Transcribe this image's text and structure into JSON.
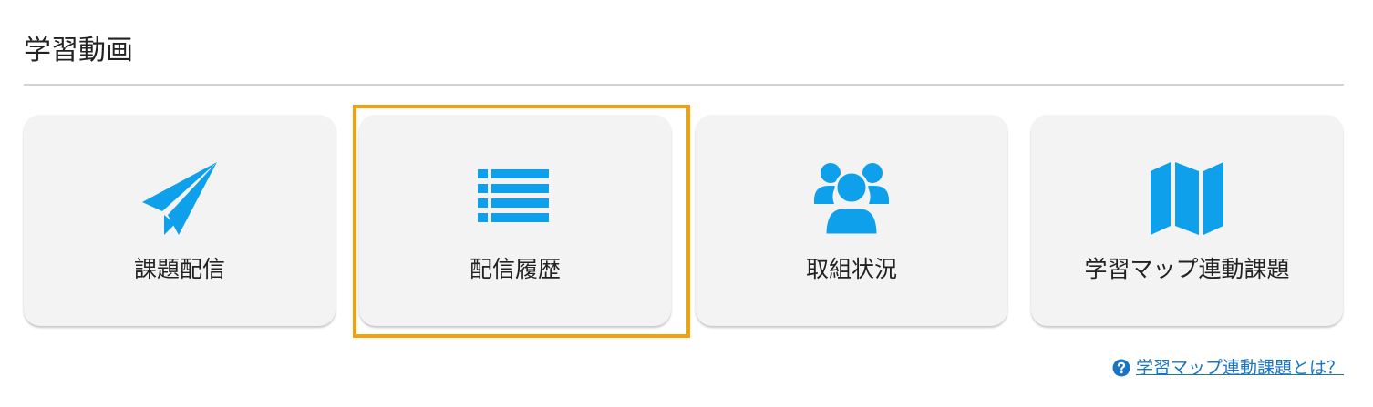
{
  "page": {
    "title": "学習動画"
  },
  "cards": [
    {
      "label": "課題配信",
      "icon": "paper-plane-icon"
    },
    {
      "label": "配信履歴",
      "icon": "list-icon"
    },
    {
      "label": "取組状況",
      "icon": "users-icon"
    },
    {
      "label": "学習マップ連動課題",
      "icon": "map-icon"
    }
  ],
  "help": {
    "link_text": "学習マップ連動課題とは？",
    "icon": "question-circle-icon"
  },
  "colors": {
    "accent_icon": "#0ea0ea",
    "highlight_border": "#f5a00a",
    "link": "#1a74c4",
    "card_bg": "#f3f3f3"
  }
}
